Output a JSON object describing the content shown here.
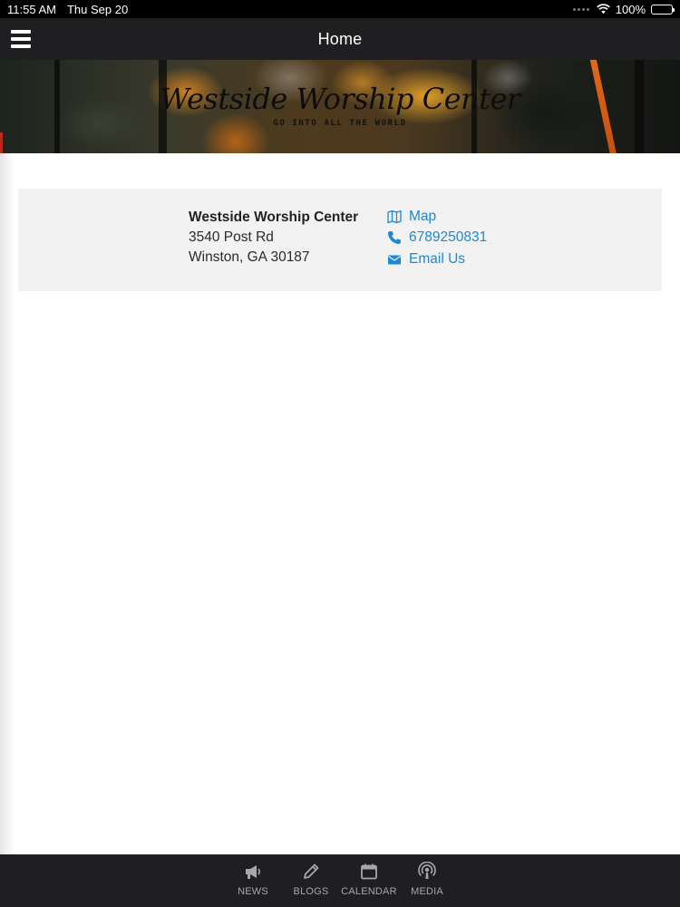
{
  "status_bar": {
    "time": "11:55 AM",
    "date": "Thu Sep 20",
    "battery": "100%",
    "battery_level": 1.0,
    "icons": [
      "cellular-dots-icon",
      "wifi-icon",
      "battery-icon"
    ]
  },
  "nav": {
    "title": "Home",
    "menu_icon": "hamburger-icon"
  },
  "banner": {
    "title": "Westside Worship Center",
    "subtitle": "GO INTO ALL THE WORLD"
  },
  "contact": {
    "name": "Westside Worship Center",
    "address_line1": "3540 Post Rd",
    "address_line2": "Winston, GA 30187",
    "links": [
      {
        "label": "Map",
        "icon": "map-icon"
      },
      {
        "label": "6789250831",
        "icon": "phone-icon"
      },
      {
        "label": "Email Us",
        "icon": "envelope-icon"
      }
    ]
  },
  "tabs": [
    {
      "label": "NEWS",
      "icon": "megaphone-icon"
    },
    {
      "label": "BLOGS",
      "icon": "pencil-icon"
    },
    {
      "label": "CALENDAR",
      "icon": "calendar-icon"
    },
    {
      "label": "MEDIA",
      "icon": "podcast-icon"
    }
  ],
  "colors": {
    "bar_background": "#1f1f21",
    "link": "#1e88d6",
    "card_background": "#f2f2f3",
    "tab_inactive": "#a7a7aa"
  }
}
